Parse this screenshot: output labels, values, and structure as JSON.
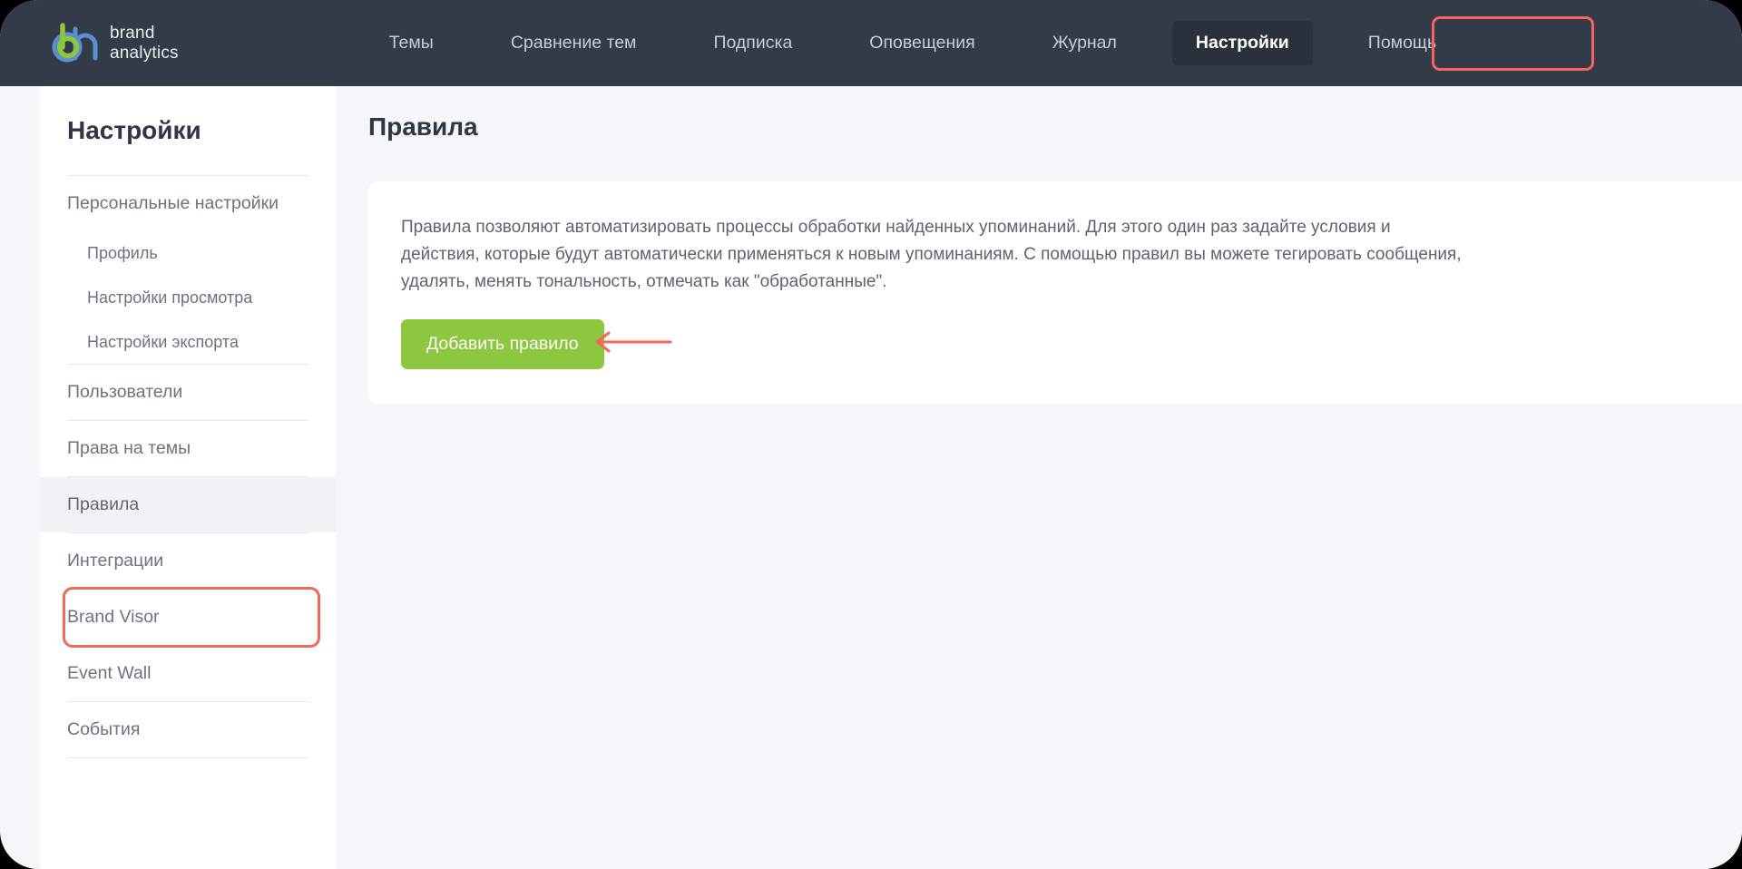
{
  "brand": {
    "line1": "brand",
    "line2": "analytics",
    "logo_icon": "brand-analytics-logo-icon",
    "green": "#8dc63f",
    "blue": "#5b8fd4"
  },
  "topnav": {
    "items": [
      {
        "label": "Темы",
        "active": false
      },
      {
        "label": "Сравнение тем",
        "active": false
      },
      {
        "label": "Подписка",
        "active": false
      },
      {
        "label": "Оповещения",
        "active": false
      },
      {
        "label": "Журнал",
        "active": false
      },
      {
        "label": "Настройки",
        "active": true
      },
      {
        "label": "Помощь",
        "active": false
      }
    ],
    "background": "#343b48"
  },
  "sidebar": {
    "title": "Настройки",
    "items": [
      {
        "label": "Персональные настройки",
        "level": "top",
        "active": false
      },
      {
        "label": "Профиль",
        "level": "sub",
        "active": false
      },
      {
        "label": "Настройки просмотра",
        "level": "sub",
        "active": false
      },
      {
        "label": "Настройки экспорта",
        "level": "sub",
        "active": false
      },
      {
        "label": "Пользователи",
        "level": "top",
        "active": false
      },
      {
        "label": "Права на темы",
        "level": "top",
        "active": false
      },
      {
        "label": "Правила",
        "level": "top",
        "active": true
      },
      {
        "label": "Интеграции",
        "level": "top",
        "active": false
      },
      {
        "label": "Brand Visor",
        "level": "top",
        "active": false
      },
      {
        "label": "Event Wall",
        "level": "top",
        "active": false
      },
      {
        "label": "События",
        "level": "top",
        "active": false
      }
    ]
  },
  "main": {
    "page_title": "Правила",
    "card": {
      "description": "Правила позволяют автоматизировать процессы обработки найденных упоминаний. Для этого один раз задайте условия и действия, которые будут автоматически применяться к новым упоминаниям. С помощью правил вы можете тегировать сообщения, удалять, менять тональность, отмечать как \"обработанные\".",
      "add_button_label": "Добавить правило"
    }
  },
  "annotations": {
    "color": "#f4675c",
    "nav_highlight_target": "Настройки",
    "sidebar_highlight_target": "Правила",
    "arrow_icon": "left-arrow-annotation-icon",
    "arrow_points_to": "Добавить правило"
  }
}
